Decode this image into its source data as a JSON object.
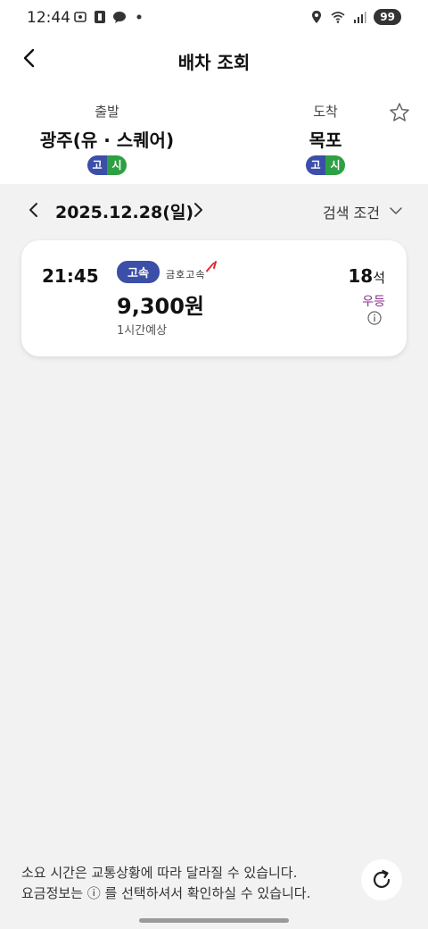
{
  "status_bar": {
    "time": "12:44",
    "battery": "99",
    "icons_left": [
      "screenshot-icon",
      "b-app-icon",
      "talk-icon",
      "dot-icon"
    ],
    "icons_right": [
      "location-icon",
      "wifi-icon",
      "signal-icon"
    ]
  },
  "header": {
    "title": "배차 조회"
  },
  "route": {
    "departure": {
      "label": "출발",
      "name": "광주(유 · 스퀘어)",
      "badges": [
        "고",
        "시"
      ]
    },
    "arrival": {
      "label": "도착",
      "name": "목포",
      "badges": [
        "고",
        "시"
      ]
    }
  },
  "date_bar": {
    "date": "2025.12.28(일)",
    "filter_label": "검색 조건"
  },
  "buses": [
    {
      "time": "21:45",
      "type": "고속",
      "company": "금호고속",
      "fare": "9,300원",
      "duration": "1시간예상",
      "seats": "18",
      "seats_unit": "석",
      "grade": "우등"
    }
  ],
  "footer": {
    "note_line1": "소요 시간은 교통상황에 따라 달라질 수 있습니다.",
    "note_line2": "요금정보는 ⓘ 를 선택하셔서 확인하실 수 있습니다."
  },
  "colors": {
    "badge_go": "#3b4fa8",
    "badge_si": "#2ea043",
    "grade": "#8a2d8f",
    "company_mark": "#e0262b",
    "background": "#f2f2f2"
  }
}
